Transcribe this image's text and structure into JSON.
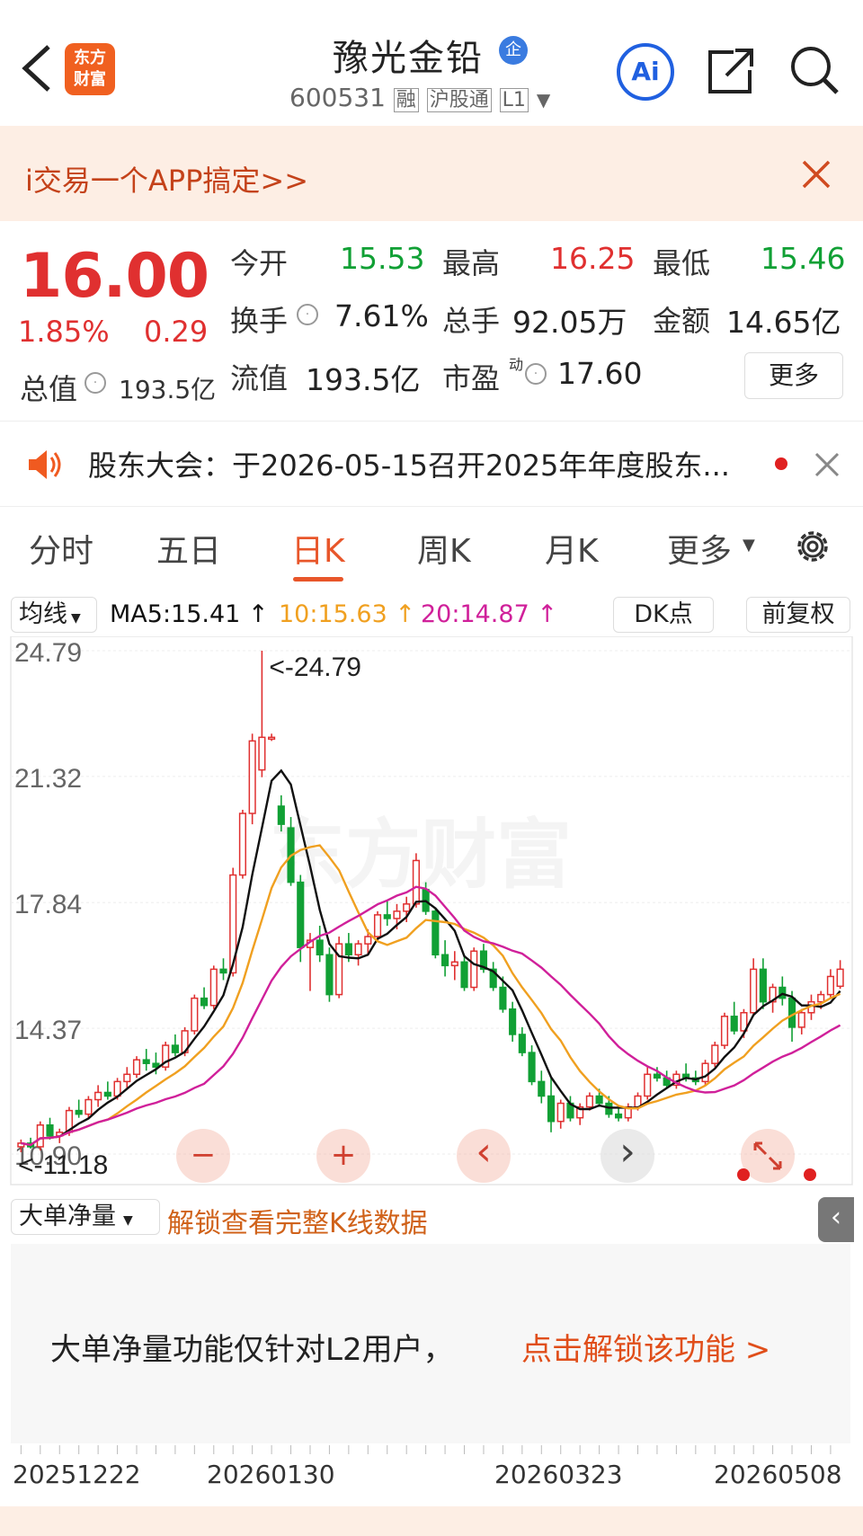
{
  "header": {
    "back_icon": "chevron-left-icon",
    "logo_text_1": "东方",
    "logo_text_2": "财富",
    "title": "豫光金铅",
    "enterprise_badge": "企",
    "code": "600531",
    "tag_margin": "融",
    "tag_connect": "沪股通",
    "tag_level": "L1",
    "ai_label": "Ai",
    "share_icon": "share-icon",
    "search_icon": "search-icon"
  },
  "banner": {
    "text": "i交易一个APP搞定>>",
    "close_icon": "close-icon"
  },
  "quote": {
    "price": "16.00",
    "pct": "1.85%",
    "change": "0.29",
    "open_label": "今开",
    "open": "15.53",
    "high_label": "最高",
    "high": "16.25",
    "low_label": "最低",
    "low": "15.46",
    "turnover_label": "换手",
    "turnover": "7.61%",
    "volume_label": "总手",
    "volume": "92.05万",
    "amount_label": "金额",
    "amount": "14.65亿",
    "mktcap_label": "总值",
    "mktcap": "193.5亿",
    "float_label": "流值",
    "float": "193.5亿",
    "pe_label": "市盈",
    "pe_sup": "动",
    "pe": "17.60",
    "more_button": "更多"
  },
  "notice": {
    "text": "股东大会：于2026-05-15召开2025年年度股东...",
    "speaker_icon": "speaker-icon",
    "close_icon": "close-icon"
  },
  "tabs": {
    "items": [
      "分时",
      "五日",
      "日K",
      "周K",
      "月K",
      "更多"
    ],
    "active": "日K",
    "settings_icon": "gear-icon"
  },
  "chartbar": {
    "ma_select": "均线",
    "ma5": "MA5:15.41 ↑",
    "ma10": "10:15.63 ↑",
    "ma20": "20:14.87 ↑",
    "dk_button": "DK点",
    "adjust_button": "前复权"
  },
  "chart_data": {
    "type": "candlestick",
    "y_ticks": [
      "24.79",
      "21.32",
      "17.84",
      "14.37",
      "10.90"
    ],
    "max_annotation": "<-24.79",
    "min_annotation": "<-11.18",
    "watermark": "东方财富",
    "x_labels": [
      "20251222",
      "20260130",
      "20260323",
      "20260508"
    ],
    "ylim": [
      10.9,
      24.79
    ],
    "candles": [
      [
        11.1,
        11.3,
        10.95,
        11.2
      ],
      [
        11.2,
        11.35,
        11.05,
        11.1
      ],
      [
        11.1,
        11.8,
        11.0,
        11.7
      ],
      [
        11.7,
        11.9,
        11.3,
        11.4
      ],
      [
        11.4,
        11.6,
        11.2,
        11.5
      ],
      [
        11.5,
        12.2,
        11.4,
        12.1
      ],
      [
        12.1,
        12.4,
        11.9,
        12.0
      ],
      [
        12.0,
        12.5,
        11.9,
        12.4
      ],
      [
        12.4,
        12.8,
        12.2,
        12.6
      ],
      [
        12.6,
        12.9,
        12.4,
        12.5
      ],
      [
        12.5,
        13.0,
        12.4,
        12.9
      ],
      [
        12.9,
        13.3,
        12.7,
        13.1
      ],
      [
        13.1,
        13.6,
        13.0,
        13.5
      ],
      [
        13.5,
        13.8,
        13.2,
        13.4
      ],
      [
        13.4,
        13.7,
        13.1,
        13.3
      ],
      [
        13.3,
        14.0,
        13.2,
        13.9
      ],
      [
        13.9,
        14.2,
        13.6,
        13.7
      ],
      [
        13.7,
        14.4,
        13.6,
        14.3
      ],
      [
        14.3,
        15.3,
        14.2,
        15.2
      ],
      [
        15.2,
        15.5,
        14.9,
        15.0
      ],
      [
        15.0,
        16.1,
        14.9,
        16.0
      ],
      [
        16.0,
        16.3,
        15.7,
        15.9
      ],
      [
        15.9,
        18.8,
        15.8,
        18.6
      ],
      [
        18.6,
        20.4,
        18.5,
        20.3
      ],
      [
        20.3,
        22.5,
        20.0,
        22.3
      ],
      [
        21.5,
        24.79,
        21.3,
        22.4
      ],
      [
        22.4,
        22.5,
        22.3,
        22.4
      ],
      [
        20.5,
        20.8,
        19.8,
        20.0
      ],
      [
        19.9,
        20.2,
        18.3,
        18.4
      ],
      [
        18.4,
        18.6,
        16.2,
        16.6
      ],
      [
        16.6,
        17.0,
        15.4,
        16.8
      ],
      [
        16.8,
        17.2,
        16.2,
        16.4
      ],
      [
        16.4,
        16.6,
        15.1,
        15.3
      ],
      [
        15.3,
        16.9,
        15.2,
        16.7
      ],
      [
        16.7,
        17.0,
        16.2,
        16.4
      ],
      [
        16.4,
        16.8,
        16.1,
        16.7
      ],
      [
        16.7,
        17.1,
        16.4,
        16.9
      ],
      [
        16.9,
        17.6,
        16.8,
        17.5
      ],
      [
        17.5,
        17.9,
        17.2,
        17.4
      ],
      [
        17.4,
        17.8,
        17.1,
        17.6
      ],
      [
        17.6,
        18.0,
        17.3,
        17.8
      ],
      [
        17.8,
        19.2,
        17.7,
        19.0
      ],
      [
        18.2,
        18.4,
        17.5,
        17.6
      ],
      [
        17.6,
        17.7,
        16.3,
        16.4
      ],
      [
        16.4,
        16.8,
        15.8,
        16.1
      ],
      [
        16.1,
        16.5,
        15.7,
        16.2
      ],
      [
        16.2,
        16.4,
        15.4,
        15.5
      ],
      [
        15.5,
        16.6,
        15.4,
        16.5
      ],
      [
        16.5,
        16.7,
        15.9,
        16.0
      ],
      [
        16.0,
        16.2,
        15.4,
        15.5
      ],
      [
        15.5,
        15.8,
        14.8,
        14.9
      ],
      [
        14.9,
        15.1,
        14.0,
        14.2
      ],
      [
        14.2,
        14.4,
        13.6,
        13.7
      ],
      [
        13.7,
        13.9,
        12.8,
        12.9
      ],
      [
        12.9,
        13.2,
        12.3,
        12.5
      ],
      [
        12.5,
        13.0,
        11.5,
        11.8
      ],
      [
        11.8,
        12.4,
        11.6,
        12.3
      ],
      [
        12.3,
        12.5,
        11.8,
        11.9
      ],
      [
        11.9,
        12.3,
        11.7,
        12.2
      ],
      [
        12.2,
        12.6,
        12.1,
        12.5
      ],
      [
        12.5,
        12.7,
        12.2,
        12.3
      ],
      [
        12.3,
        12.5,
        11.9,
        12.0
      ],
      [
        12.0,
        12.2,
        11.8,
        11.9
      ],
      [
        11.9,
        12.3,
        11.8,
        12.2
      ],
      [
        12.2,
        12.6,
        12.1,
        12.5
      ],
      [
        12.5,
        13.3,
        12.4,
        13.1
      ],
      [
        13.1,
        13.3,
        12.9,
        13.0
      ],
      [
        13.0,
        13.2,
        12.7,
        12.8
      ],
      [
        12.8,
        13.2,
        12.7,
        13.1
      ],
      [
        13.1,
        13.4,
        12.9,
        13.0
      ],
      [
        13.0,
        13.2,
        12.8,
        12.9
      ],
      [
        12.9,
        13.5,
        12.8,
        13.4
      ],
      [
        13.4,
        14.0,
        13.3,
        13.9
      ],
      [
        13.9,
        14.8,
        13.8,
        14.7
      ],
      [
        14.7,
        15.1,
        14.2,
        14.3
      ],
      [
        14.3,
        14.9,
        14.1,
        14.8
      ],
      [
        14.8,
        16.3,
        14.7,
        16.0
      ],
      [
        16.0,
        16.3,
        14.9,
        15.1
      ],
      [
        15.1,
        15.6,
        14.8,
        15.5
      ],
      [
        15.5,
        15.8,
        15.0,
        15.2
      ],
      [
        15.2,
        15.4,
        14.0,
        14.4
      ],
      [
        14.4,
        14.9,
        14.2,
        14.8
      ],
      [
        14.8,
        15.3,
        14.6,
        15.1
      ],
      [
        15.1,
        15.4,
        14.9,
        15.3
      ],
      [
        15.3,
        16.0,
        15.2,
        15.8
      ],
      [
        15.53,
        16.25,
        15.46,
        16.0
      ]
    ]
  },
  "chart_controls": {
    "zoom_out": "−",
    "zoom_in": "+",
    "prev": "‹",
    "next": "›",
    "fullscreen_icon": "expand-icon"
  },
  "lower": {
    "indicator_select": "大单净量",
    "unlock_text": "解锁查看完整K线数据",
    "panel_text": "大单净量功能仅针对L2用户，",
    "panel_link": "点击解锁该功能 >",
    "side_icon": "chevron-left-icon"
  },
  "colors": {
    "up": "#e03030",
    "down": "#11a035",
    "ma5": "#111111",
    "ma10": "#f0a020",
    "ma20": "#d0209a",
    "accent": "#e8562a"
  }
}
